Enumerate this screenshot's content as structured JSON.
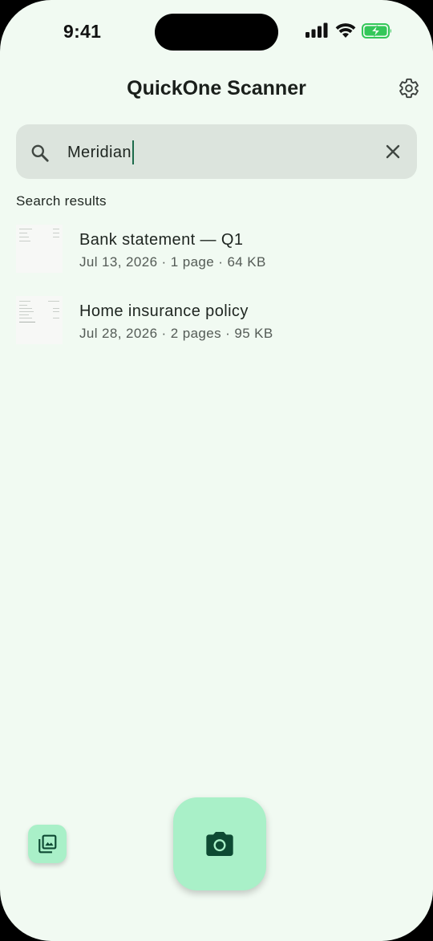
{
  "status_bar": {
    "time": "9:41"
  },
  "header": {
    "title": "QuickOne Scanner",
    "settings_icon": "gear-icon"
  },
  "search": {
    "value": "Meridian",
    "icon": "search-icon",
    "clear_icon": "close-icon"
  },
  "results": {
    "label": "Search results",
    "items": [
      {
        "title": "Bank statement — Q1",
        "meta": "Jul 13, 2026 · 1 page · 64 KB"
      },
      {
        "title": "Home insurance policy",
        "meta": "Jul 28, 2026 · 2 pages · 95 KB"
      }
    ]
  },
  "actions": {
    "gallery_icon": "photo-library-icon",
    "camera_icon": "camera-icon"
  },
  "colors": {
    "background": "#F1FAF2",
    "search_field": "#DCE4DD",
    "fab": "#A9F0C8",
    "fab_icon": "#0E4A33",
    "caret": "#1C6B4B",
    "battery": "#34C759"
  }
}
